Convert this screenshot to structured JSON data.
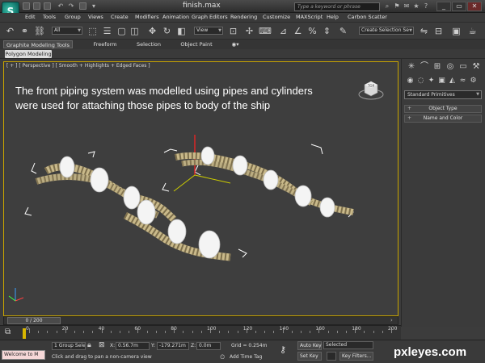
{
  "window": {
    "title": "finish.max",
    "search_placeholder": "Type a keyword or phrase",
    "controls": [
      "_",
      "▭",
      "✕"
    ]
  },
  "menubar": {
    "items": [
      "Edit",
      "Tools",
      "Group",
      "Views",
      "Create",
      "Modifiers",
      "Animation",
      "Graph Editors",
      "Rendering",
      "Customize",
      "MAXScript",
      "Help",
      "Carbon Scatter"
    ]
  },
  "toolbar": {
    "selection_filter": "All",
    "ref_coord": "View",
    "named_selection": "Create Selection Se"
  },
  "ribbon": {
    "tabs": [
      "Graphite Modeling Tools",
      "Freeform",
      "Selection",
      "Object Paint"
    ],
    "active_subtab": "Polygon Modeling"
  },
  "viewport": {
    "label": "[ + ] [ Perspective ] [ Smooth + Highlights + Edged Faces ]",
    "annotation": "The front piping system was modelled using pipes and cylinders were used for attaching those pipes to body of the ship",
    "viewcube_label": "TOP"
  },
  "command_panel": {
    "primitive_type": "Standard Primitives",
    "rollouts": [
      "Object Type",
      "Name and Color"
    ]
  },
  "timeline": {
    "slider_label": "0 / 200",
    "ticks": [
      "0",
      "20",
      "40",
      "60",
      "80",
      "100",
      "120",
      "140",
      "160",
      "180",
      "200"
    ]
  },
  "statusbar": {
    "maxscript_text": "Welcome to M",
    "selection_info": "1 Group Selec",
    "x_label": "X:",
    "x_value": "0.56.7m",
    "y_label": "Y:",
    "y_value": "-179.271m",
    "z_label": "Z:",
    "z_value": "0.0m",
    "grid": "Grid = 0.254m",
    "prompt": "Click and drag to pan a non-camera view",
    "add_time_tag": "Add Time Tag",
    "auto_key": "Auto Key",
    "auto_key_mode": "Selected",
    "set_key": "Set Key",
    "key_filters": "Key Filters..."
  },
  "watermark": "pxleyes.com"
}
